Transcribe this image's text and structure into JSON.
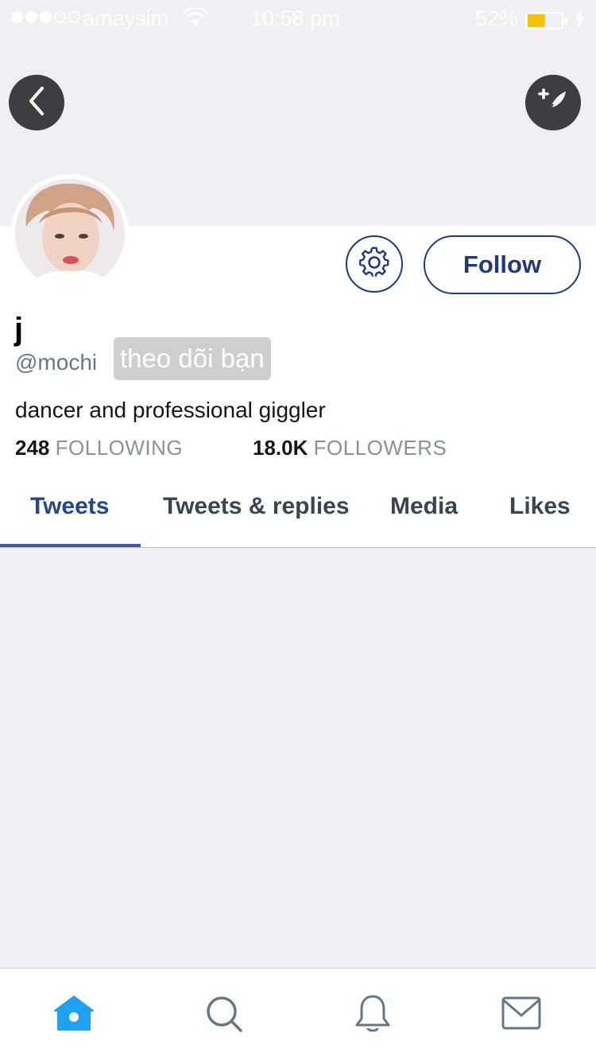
{
  "status_bar": {
    "carrier": "amaysim",
    "time": "10:58 pm",
    "battery_percent": "52%",
    "battery_level": 0.52,
    "signal_bars_filled": 3,
    "signal_bars_total": 5
  },
  "profile": {
    "display_name": "j",
    "handle": "@mochi",
    "follows_you_badge": "theo dõi bạn",
    "bio": "dancer and professional giggler",
    "following_count": "248",
    "following_label": "FOLLOWING",
    "followers_count": "18.0K",
    "followers_label": "FOLLOWERS"
  },
  "actions": {
    "follow_label": "Follow"
  },
  "tabs": [
    {
      "label": "Tweets",
      "active": true
    },
    {
      "label": "Tweets & replies",
      "active": false
    },
    {
      "label": "Media",
      "active": false
    },
    {
      "label": "Likes",
      "active": false
    }
  ],
  "icons": {
    "back": "chevron-left-icon",
    "compose": "compose-tweet-icon",
    "settings": "gear-icon",
    "home": "home-icon",
    "search": "search-icon",
    "notifications": "bell-icon",
    "messages": "envelope-icon"
  },
  "colors": {
    "accent": "#1e3a7b",
    "home_active": "#1da1f2",
    "inactive_icon": "#657786"
  }
}
